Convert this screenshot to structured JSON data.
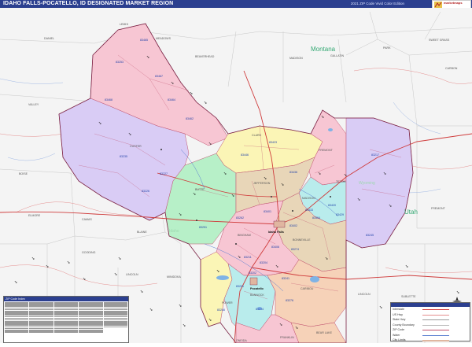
{
  "header": {
    "title": "IDAHO FALLS-POCATELLO, ID DESIGNATED MARKET REGION",
    "edition": "2021 ZIP Code Vivid Color Edition"
  },
  "logo": {
    "text": "marketmaps"
  },
  "map": {
    "colors": {
      "background": "#f4f4f4",
      "pink": "#f7c6d3",
      "lavender": "#d9ccf5",
      "yellow": "#fbf5b6",
      "green": "#b7f0c8",
      "tan": "#e8d6b8",
      "peach": "#f6d2b8",
      "aqua": "#b9ecec",
      "county_line": "#bbbbbb",
      "zip_line": "#c0506e",
      "road_red": "#cf3b3b",
      "road_blue": "#5a7fd1",
      "water": "#7fb3e6",
      "zip_label": "#1d3fa8",
      "place_label": "#444444",
      "region_label": "#33a873"
    },
    "major_city": "Idaho Falls",
    "secondary_city": "Pocatello",
    "region_labels": [
      "Montana",
      "Utah"
    ],
    "county_labels": [
      "DANIEL",
      "LEMHI",
      "MEADOWS",
      "BEAVERHEAD",
      "MADISON",
      "GALLATIN",
      "PARK",
      "SWEET GRASS",
      "CARBON",
      "VALLEY",
      "CUSTER",
      "CLARK",
      "FREMONT",
      "TETON",
      "BOISE",
      "BUTTE",
      "JEFFERSON",
      "MADISON",
      "BONNEVILLE",
      "ELMORE",
      "CAMAS",
      "BLAINE",
      "BINGHAM",
      "GOODING",
      "LINCOLN",
      "MINIDOKA",
      "POWER",
      "BANNOCK",
      "CARIBOU",
      "ONEIDA",
      "FRANKLIN",
      "BEAR LAKE",
      "LINCOLN",
      "SUBLETTE",
      "FREMONT"
    ],
    "zip_labels": [
      "83465",
      "83253",
      "83467",
      "83464",
      "83468",
      "83462",
      "83235",
      "83227",
      "83226",
      "83251",
      "83446",
      "83423",
      "83436",
      "83420",
      "83429",
      "83433",
      "83401",
      "83402",
      "83404",
      "83406",
      "83274",
      "83262",
      "83211",
      "83204",
      "83201",
      "83202",
      "83246",
      "83234",
      "83241",
      "83276",
      "83217",
      "83245"
    ]
  },
  "zip_table": {
    "title": "ZIP Code Index"
  },
  "legend": {
    "title": "Legend",
    "items": [
      "Interstate",
      "US Hwy",
      "State Hwy",
      "County Boundary",
      "ZIP Code",
      "Water",
      "City Limits"
    ]
  },
  "compass": {
    "label": "N"
  }
}
